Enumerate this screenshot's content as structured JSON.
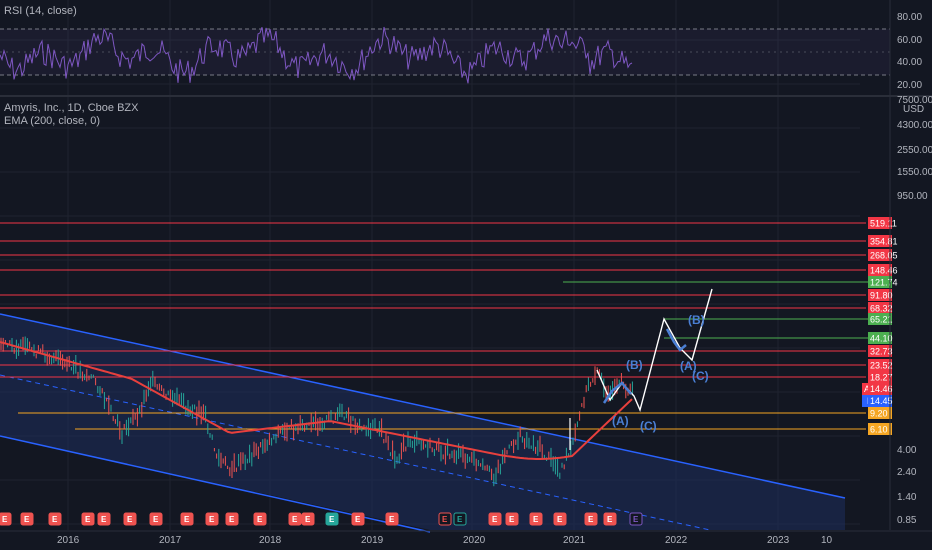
{
  "colors": {
    "background": "#131722",
    "grid": "#1f2330",
    "rsi_line": "#7e57c2",
    "ema_line": "#e8403d",
    "channel_line": "#2962ff",
    "channel_fill": "#1e2d5c",
    "resistance_line": "#f23645",
    "support_line": "#f5a623",
    "target_line": "#4caf50",
    "wave_label": "#4a7fd4",
    "projection_line": "#ffffff",
    "price_up": "#26a69a",
    "price_down": "#ef5350"
  },
  "rsi_panel": {
    "title": "RSI (14, close)",
    "ticks": [
      "80.00",
      "60.00",
      "40.00",
      "20.00"
    ],
    "upper_band": 70,
    "lower_band": 30
  },
  "price_panel": {
    "title": "Amyris, Inc., 1D, Cboe BZX",
    "subtitle": "EMA (200, close, 0)",
    "currency": "USD",
    "axis_ticks": [
      "7500.00",
      "4300.00",
      "2550.00",
      "1550.00",
      "950.00",
      "4.00",
      "2.40",
      "1.40",
      "0.85"
    ],
    "symbol_tag": "AMRS",
    "last_price": "14.46",
    "post_label": "Post",
    "post_price": "14.45"
  },
  "x_axis": [
    "2016",
    "2017",
    "2018",
    "2019",
    "2020",
    "2021",
    "2022",
    "2023",
    "10"
  ],
  "chart_data": {
    "type": "line",
    "title": "Amyris, Inc., 1D, Cboe BZX",
    "y_scale": "log",
    "resistance_levels": [
      {
        "label": "519.11",
        "color": "#f23645"
      },
      {
        "label": "354.81",
        "color": "#f23645"
      },
      {
        "label": "268.05",
        "color": "#f23645"
      },
      {
        "label": "148.46",
        "color": "#f23645"
      },
      {
        "label": "121.74",
        "color": "#4caf50"
      },
      {
        "label": "91.80",
        "color": "#f23645"
      },
      {
        "label": "68.32",
        "color": "#f23645"
      },
      {
        "label": "65.21",
        "color": "#4caf50"
      },
      {
        "label": "44.10",
        "color": "#4caf50"
      },
      {
        "label": "32.73",
        "color": "#f23645"
      },
      {
        "label": "23.52",
        "color": "#f23645"
      },
      {
        "label": "18.27",
        "color": "#f23645"
      },
      {
        "label": "9.20",
        "color": "#f5a623"
      },
      {
        "label": "6.10",
        "color": "#f5a623"
      }
    ],
    "wave_labels": [
      "(A)",
      "(B)",
      "(C)",
      "(A)",
      "(B)",
      "(C)"
    ],
    "series": [
      {
        "name": "EMA (200, close, 0)"
      }
    ]
  },
  "earnings_markers": [
    "E",
    "E",
    "E",
    "E",
    "E",
    "E",
    "E",
    "E",
    "E",
    "E",
    "E",
    "E",
    "E",
    "E",
    "E",
    "E",
    "E",
    "E",
    "E",
    "E",
    "E",
    "E",
    "E",
    "E",
    "E",
    "E"
  ]
}
